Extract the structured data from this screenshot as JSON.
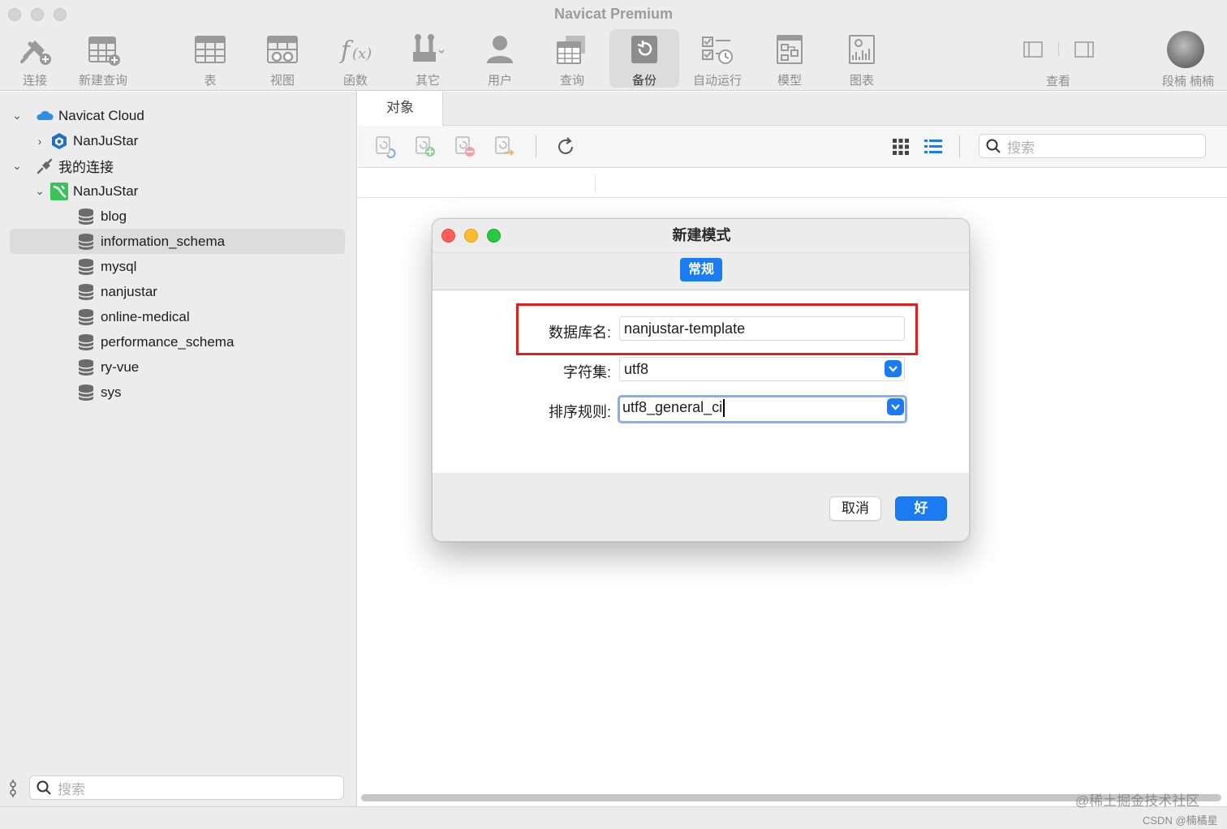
{
  "app": {
    "title": "Navicat Premium"
  },
  "toolbar": {
    "items": [
      {
        "label": "连接",
        "icon": "connection-plug-icon"
      },
      {
        "label": "新建查询",
        "icon": "new-query-icon"
      },
      {
        "label": "表",
        "icon": "table-icon"
      },
      {
        "label": "视图",
        "icon": "view-icon"
      },
      {
        "label": "函数",
        "icon": "function-icon"
      },
      {
        "label": "其它",
        "icon": "tools-icon"
      },
      {
        "label": "用户",
        "icon": "user-icon"
      },
      {
        "label": "查询",
        "icon": "query-icon"
      },
      {
        "label": "备份",
        "icon": "backup-icon"
      },
      {
        "label": "自动运行",
        "icon": "automation-icon"
      },
      {
        "label": "模型",
        "icon": "model-icon"
      },
      {
        "label": "图表",
        "icon": "chart-icon"
      }
    ],
    "view_label": "查看",
    "user_label": "段楠 楠楠"
  },
  "sidebar": {
    "tree": [
      {
        "label": "Navicat Cloud",
        "icon": "cloud-icon"
      },
      {
        "label": "NanJuStar",
        "icon": "cloud-project-icon"
      },
      {
        "label": "我的连接",
        "icon": "connection-icon"
      },
      {
        "label": "NanJuStar",
        "icon": "mysql-connection-icon"
      }
    ],
    "databases": [
      "blog",
      "information_schema",
      "mysql",
      "nanjustar",
      "online-medical",
      "performance_schema",
      "ry-vue",
      "sys"
    ],
    "selected": "information_schema",
    "search_placeholder": "搜索"
  },
  "main": {
    "tab_label": "对象",
    "search_placeholder": "搜索"
  },
  "dialog": {
    "title": "新建模式",
    "tab_label": "常规",
    "fields": {
      "db_name_label": "数据库名:",
      "db_name_value": "nanjustar-template",
      "charset_label": "字符集:",
      "charset_value": "utf8",
      "collation_label": "排序规则:",
      "collation_value": "utf8_general_ci"
    },
    "cancel_label": "取消",
    "ok_label": "好"
  },
  "watermark": {
    "main": "@稀土掘金技术社区",
    "sub": "CSDN @楠橘星"
  },
  "colors": {
    "accent": "#1a7cf0",
    "highlight_red": "#e02020",
    "traffic_red": "#ff5f57",
    "traffic_yellow": "#febc2e",
    "traffic_green": "#28c840"
  }
}
